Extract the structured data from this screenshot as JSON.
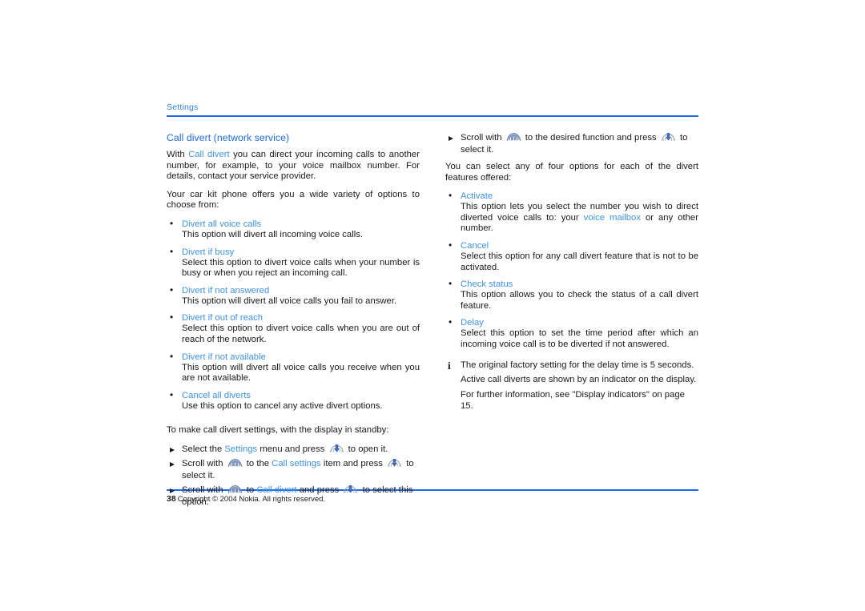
{
  "running_head": "Settings",
  "page_number": "38",
  "footer_text": "Copyright © 2004 Nokia. All rights reserved.",
  "colors": {
    "heading_blue": "#1b6ce8",
    "link_blue": "#3d93e8",
    "rule_blue": "#1b6ce8",
    "body_text": "#1a1a1a"
  },
  "left_column": {
    "section_title": "Call divert (network service)",
    "intro_1": {
      "pre": "With ",
      "link": "Call divert",
      "post": " you can direct your incoming calls to another number, for example, to your voice mailbox number. For details, contact your service provider."
    },
    "intro_2": "Your car kit phone offers you a wide variety of options to choose from:",
    "options": [
      {
        "term": "Divert all voice calls",
        "desc": "This option will divert all incoming voice calls."
      },
      {
        "term": "Divert if busy",
        "desc": "Select this option to divert voice calls when your number is busy or when you reject an incoming call."
      },
      {
        "term": "Divert if not answered",
        "desc": "This option will divert all voice calls you fail to answer."
      },
      {
        "term": "Divert if out of reach",
        "desc": "Select this option to divert voice calls when you are out of reach of the network."
      },
      {
        "term": "Divert if not available",
        "desc": "This option will divert all voice calls you receive when you are not available."
      },
      {
        "term": "Cancel all diverts",
        "desc": "Use this option to cancel any active divert options."
      }
    ],
    "procedure_intro": "To make call divert settings, with the display in standby:",
    "steps": [
      {
        "p1": "Select the ",
        "link1": "Settings",
        "p2": " menu and press ",
        "icon1": "press-key-icon",
        "p3": " to open it.",
        "link2": "",
        "p4": "",
        "icon2": "",
        "p5": ""
      },
      {
        "p1": "Scroll with ",
        "icon1": "scroll-key-icon",
        "p2": " to the ",
        "link1": "Call settings",
        "p3": " item and press ",
        "icon2": "press-key-icon",
        "p4": " to select it."
      },
      {
        "p1": "Scroll with ",
        "icon1": "scroll-key-icon",
        "p2": " to ",
        "link1": "Call divert",
        "p3": " and press ",
        "icon2": "press-key-icon",
        "p4": " to select this option."
      }
    ]
  },
  "right_column": {
    "step_top": {
      "p1": "Scroll with ",
      "icon1": "scroll-key-icon",
      "p2": " to the desired function and press ",
      "icon2": "press-key-icon",
      "p3": " to select it."
    },
    "intro": "You can select any of four options for each of the divert features offered:",
    "options": [
      {
        "term": "Activate",
        "desc_pre": "This option lets you select the number you wish to direct diverted voice calls to: your ",
        "desc_link": "voice mailbox",
        "desc_post": " or any other number."
      },
      {
        "term": "Cancel",
        "desc": "Select this option for any call divert feature that is not to be activated."
      },
      {
        "term": "Check status",
        "desc": "This option allows you to check the status of a call divert feature."
      },
      {
        "term": "Delay",
        "desc": "Select this option to set the time period after which an incoming voice call is to be diverted if not answered."
      }
    ],
    "note": {
      "glyph": "i",
      "line1": "The original factory setting for the delay time is 5 seconds.",
      "line2": "Active call diverts are shown by an indicator on the display.",
      "line3": "For further information, see \"Display indicators\" on page 15."
    }
  }
}
